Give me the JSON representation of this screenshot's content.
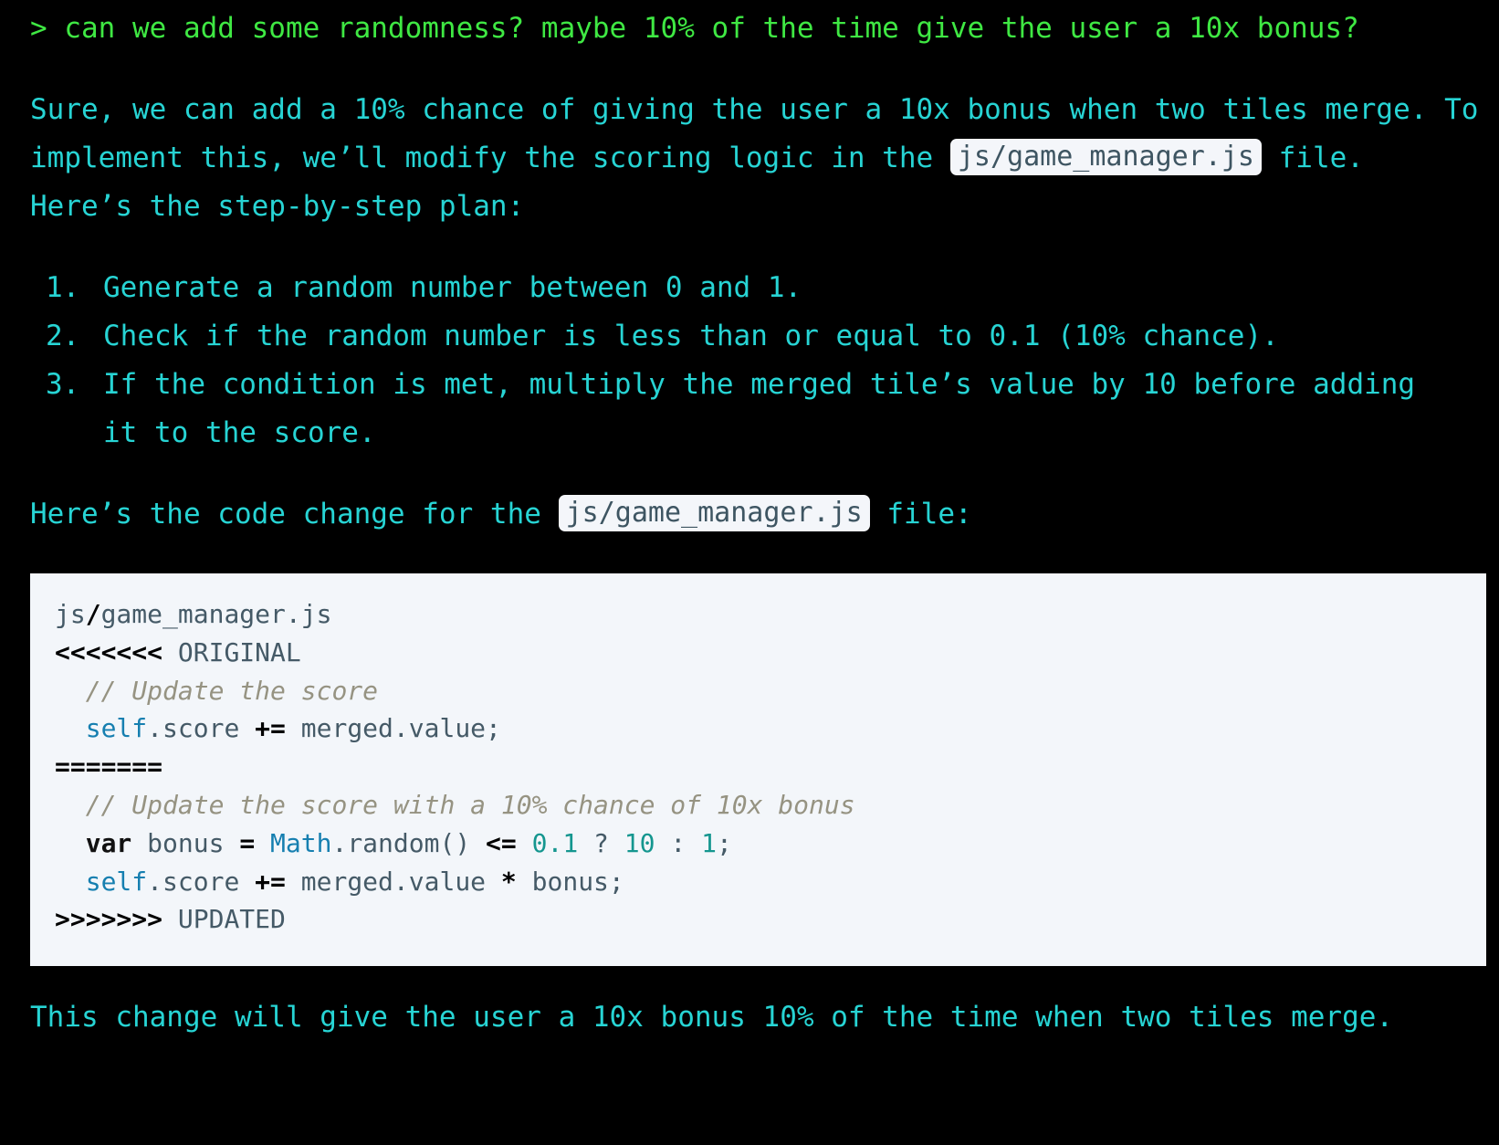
{
  "prompt": {
    "text": "> can we add some randomness? maybe 10% of the time give the user a 10x bonus?"
  },
  "intro": {
    "part1": "Sure, we can add a 10% chance of giving the user a 10x bonus when two tiles merge. To implement this, we’ll modify the scoring logic in the ",
    "file_chip": "js/game_manager.js",
    "part2": " file. Here’s the step-by-step plan:"
  },
  "plan": {
    "steps": [
      {
        "num": "1.",
        "text": "Generate a random number between 0 and 1."
      },
      {
        "num": "2.",
        "text": "Check if the random number is less than or equal to 0.1 (10% chance)."
      },
      {
        "num": "3.",
        "text": "If the condition is met, multiply the merged tile’s value by 10 before adding it to the score."
      }
    ]
  },
  "code_intro": {
    "part1": "Here’s the code change for the ",
    "file_chip": "js/game_manager.js",
    "part2": " file:"
  },
  "code": {
    "l1": {
      "a": "js",
      "b": "/",
      "c": "game_manager.js"
    },
    "l2": {
      "marker": "<<<<<<<",
      "label": " ORIGINAL"
    },
    "l3": {
      "indent": "  ",
      "comment": "// Update the score"
    },
    "l4": {
      "indent": "  ",
      "self": "self",
      "rest1": ".score ",
      "op": "+=",
      "rest2": " merged.value;"
    },
    "l5": {
      "marker": "======="
    },
    "l6": {
      "indent": "  ",
      "comment": "// Update the score with a 10% chance of 10x bonus"
    },
    "l7": {
      "indent": "  ",
      "kw": "var",
      "v1": " bonus ",
      "op1": "=",
      "sp1": " ",
      "math": "Math",
      "v2": ".random() ",
      "op2": "<=",
      "sp2": " ",
      "n1": "0.1",
      "v3": " ? ",
      "n2": "10",
      "v4": " : ",
      "n3": "1",
      "v5": ";"
    },
    "l8": {
      "indent": "  ",
      "self": "self",
      "rest1": ".score ",
      "op": "+=",
      "rest2": " merged.value ",
      "op2": "*",
      "rest3": " bonus;"
    },
    "l9": {
      "marker": ">>>>>>>",
      "label": " UPDATED"
    }
  },
  "closing": {
    "text": "This change will give the user a 10x bonus 10% of the time when two tiles merge."
  },
  "colors": {
    "background": "#000000",
    "prompt_green": "#3fe843",
    "assistant_cyan": "#27d4d4",
    "code_background": "#f3f6fa"
  }
}
